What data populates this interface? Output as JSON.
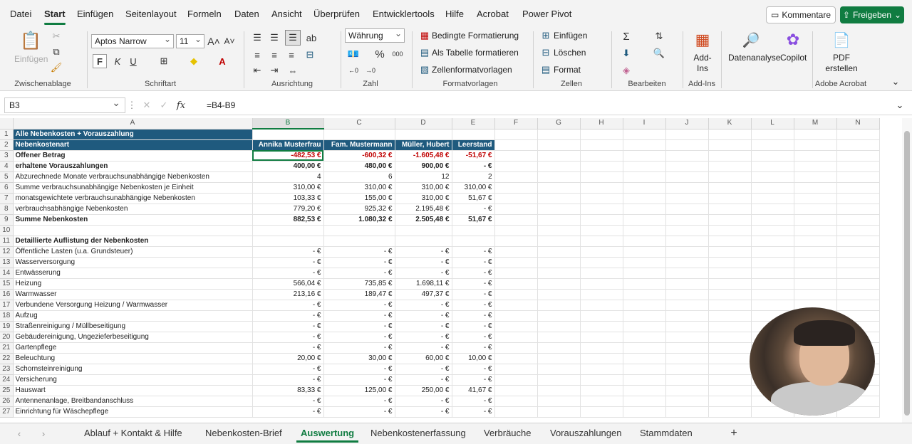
{
  "menu": {
    "tabs": [
      "Datei",
      "Start",
      "Einfügen",
      "Seitenlayout",
      "Formeln",
      "Daten",
      "Ansicht",
      "Überprüfen",
      "Entwicklertools",
      "Hilfe",
      "Acrobat",
      "Power Pivot"
    ],
    "active_tab": "Start",
    "comments": "Kommentare",
    "share": "Freigeben"
  },
  "ribbon": {
    "clipboard": {
      "paste": "Einfügen",
      "label": "Zwischenablage"
    },
    "font": {
      "name": "Aptos Narrow",
      "size": "11",
      "bold": "F",
      "italic": "K",
      "underline": "U",
      "label": "Schriftart"
    },
    "alignment": {
      "label": "Ausrichtung"
    },
    "number": {
      "format": "Währung",
      "label": "Zahl"
    },
    "styles": {
      "conditional": "Bedingte Formatierung",
      "table": "Als Tabelle formatieren",
      "cell_styles": "Zellenformatvorlagen",
      "label": "Formatvorlagen"
    },
    "cells": {
      "insert": "Einfügen",
      "delete": "Löschen",
      "format": "Format",
      "label": "Zellen"
    },
    "editing": {
      "label": "Bearbeiten"
    },
    "addins": {
      "button": "Add-Ins",
      "label": "Add-Ins"
    },
    "analysis": {
      "data_analysis": "Datenanalyse",
      "copilot": "Copilot"
    },
    "acrobat": {
      "pdf": "PDF erstellen",
      "label": "Adobe Acrobat"
    }
  },
  "formula_bar": {
    "cell": "B3",
    "fx": "fx",
    "formula": "=B4-B9"
  },
  "columns": [
    "A",
    "B",
    "C",
    "D",
    "E",
    "F",
    "G",
    "H",
    "I",
    "J",
    "K",
    "L",
    "M",
    "N"
  ],
  "rows": [
    {
      "n": "1",
      "a": "Alle Nebenkosten + Vorauszahlung",
      "b": "",
      "c": "",
      "d": "",
      "e": ""
    },
    {
      "n": "2",
      "a": "Nebenkostenart",
      "b": "Annika Musterfrau",
      "c": "Fam. Mustermann",
      "d": "Müller, Hubert",
      "e": "Leerstand"
    },
    {
      "n": "3",
      "a": "Offener Betrag",
      "b": "-482,53 €",
      "c": "-600,32 €",
      "d": "-1.605,48 €",
      "e": "-51,67 €"
    },
    {
      "n": "4",
      "a": " erhaltene Vorauszahlungen",
      "b": "400,00 €",
      "c": "480,00 €",
      "d": "900,00 €",
      "e": "-   €"
    },
    {
      "n": "5",
      "a": "Abzurechnede Monate verbrauchsunabhängige Nebenkosten",
      "b": "4",
      "c": "6",
      "d": "12",
      "e": "2"
    },
    {
      "n": "6",
      "a": " Summe verbrauchsunabhängige Nebenkosten je Einheit",
      "b": "310,00 €",
      "c": "310,00 €",
      "d": "310,00 €",
      "e": "310,00 €"
    },
    {
      "n": "7",
      "a": " monatsgewichtete verbrauchsunabhängige Nebenkosten",
      "b": "103,33 €",
      "c": "155,00 €",
      "d": "310,00 €",
      "e": "51,67 €"
    },
    {
      "n": "8",
      "a": " verbrauchsabhängige Nebenkosten",
      "b": "779,20 €",
      "c": "925,32 €",
      "d": "2.195,48 €",
      "e": "-   €"
    },
    {
      "n": "9",
      "a": " Summe Nebenkosten",
      "b": "882,53 €",
      "c": "1.080,32 €",
      "d": "2.505,48 €",
      "e": "51,67 €"
    },
    {
      "n": "10",
      "a": "",
      "b": "",
      "c": "",
      "d": "",
      "e": ""
    },
    {
      "n": "11",
      "a": " Detaillierte Auflistung der Nebenkosten",
      "b": "",
      "c": "",
      "d": "",
      "e": ""
    },
    {
      "n": "12",
      "a": "Öffentliche Lasten (u.a. Grundsteuer)",
      "b": "-   €",
      "c": "-   €",
      "d": "-   €",
      "e": "-   €"
    },
    {
      "n": "13",
      "a": "Wasserversorgung",
      "b": "-   €",
      "c": "-   €",
      "d": "-   €",
      "e": "-   €"
    },
    {
      "n": "14",
      "a": "Entwässerung",
      "b": "-   €",
      "c": "-   €",
      "d": "-   €",
      "e": "-   €"
    },
    {
      "n": "15",
      "a": "Heizung",
      "b": "566,04 €",
      "c": "735,85 €",
      "d": "1.698,11 €",
      "e": "-   €"
    },
    {
      "n": "16",
      "a": "Warmwasser",
      "b": "213,16 €",
      "c": "189,47 €",
      "d": "497,37 €",
      "e": "-   €"
    },
    {
      "n": "17",
      "a": "Verbundene Versorgung Heizung / Warmwasser",
      "b": "-   €",
      "c": "-   €",
      "d": "-   €",
      "e": "-   €"
    },
    {
      "n": "18",
      "a": "Aufzug",
      "b": "-   €",
      "c": "-   €",
      "d": "-   €",
      "e": "-   €"
    },
    {
      "n": "19",
      "a": "Straßenreinigung / Müllbeseitigung",
      "b": "-   €",
      "c": "-   €",
      "d": "-   €",
      "e": "-   €"
    },
    {
      "n": "20",
      "a": "Gebäudereinigung, Ungezieferbeseitigung",
      "b": "-   €",
      "c": "-   €",
      "d": "-   €",
      "e": "-   €"
    },
    {
      "n": "21",
      "a": "Gartenpflege",
      "b": "-   €",
      "c": "-   €",
      "d": "-   €",
      "e": "-   €"
    },
    {
      "n": "22",
      "a": "Beleuchtung",
      "b": "20,00 €",
      "c": "30,00 €",
      "d": "60,00 €",
      "e": "10,00 €"
    },
    {
      "n": "23",
      "a": "Schornsteinreinigung",
      "b": "-   €",
      "c": "-   €",
      "d": "-   €",
      "e": "-   €"
    },
    {
      "n": "24",
      "a": "Versicherung",
      "b": "-   €",
      "c": "-   €",
      "d": "-   €",
      "e": "-   €"
    },
    {
      "n": "25",
      "a": "Hauswart",
      "b": "83,33 €",
      "c": "125,00 €",
      "d": "250,00 €",
      "e": "41,67 €"
    },
    {
      "n": "26",
      "a": "Antennenanlage, Breitbandanschluss",
      "b": "-   €",
      "c": "-   €",
      "d": "-   €",
      "e": "-   €"
    },
    {
      "n": "27",
      "a": "Einrichtung für Wäschepflege",
      "b": "-   €",
      "c": "-   €",
      "d": "-   €",
      "e": "-   €"
    }
  ],
  "sheet_tabs": [
    "Ablauf + Kontakt & Hilfe",
    "Nebenkosten-Brief",
    "Auswertung",
    "Nebenkostenerfassung",
    "Verbräuche",
    "Vorauszahlungen",
    "Stammdaten"
  ],
  "active_sheet": "Auswertung"
}
